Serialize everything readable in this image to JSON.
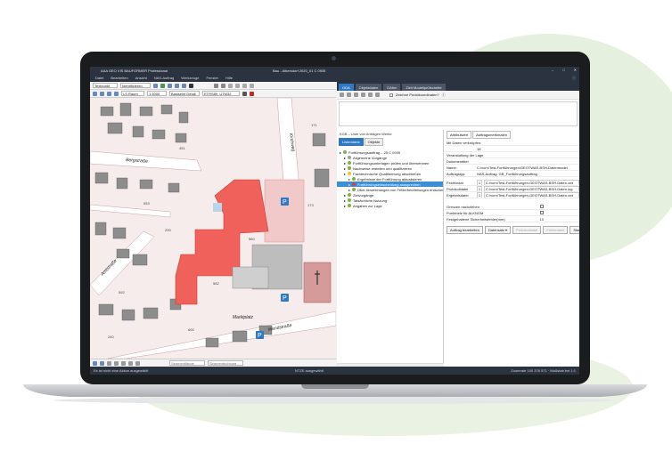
{
  "window": {
    "app_title": "AAA GEO VIS BAUFORMER Professional",
    "center_title": "Bau - Albersdorf 2020_01 C 0935",
    "controls": [
      "–",
      "□",
      "✕"
    ]
  },
  "menu": [
    "Datei",
    "Bearbeiten",
    "Ansicht",
    "NAS-Auftrag",
    "Werkzeuge",
    "Fenster",
    "Hilfe"
  ],
  "toolbar1": {
    "object_combo": "Textpunkt",
    "find_combo": "Identifizieren"
  },
  "toolbar2": {
    "crs_combo": "LS Raum",
    "scale_combo": "1:1000",
    "style_combo": "Basiseinf Detail",
    "layer_combo": "ETRS89_UTM32"
  },
  "map": {
    "streets": [
      "Bergstraße",
      "Kirchweg",
      "Amtstraße",
      "Wendstraße",
      "Marktplatz"
    ],
    "parcel_numbers": [
      "171",
      "560",
      "553",
      "582",
      "173",
      "592",
      "451",
      "200",
      "240",
      "600"
    ],
    "parking_label": "P"
  },
  "map_toolbar": {
    "segment_input_placeholder": "Segmentlänge",
    "segment_input2_placeholder": "Segmentrichtung"
  },
  "status": {
    "left": "Es ist nicht eine Aktion ausgewählt",
    "center": "NTZE ausgewählt",
    "right": "Zoomrate 100 376 571 · Maßstab bei 1:1"
  },
  "right_tabs": [
    "GDA",
    "Objektdaten",
    "DAfen",
    "Zielt Modellprüfschritte"
  ],
  "right_toolbar_check": "Zeichne Punktkoordinaten?",
  "tree": {
    "header": "KGB – Liste von Anträgen Werke",
    "subtabs": [
      "Listendarst",
      "Objekte"
    ],
    "items": [
      {
        "label": "Fortführungsauftrag – 25 C 0935",
        "color": "#7cb342",
        "indent": 0
      },
      {
        "label": "Allgemeine Vorgänge",
        "color": "#9e9e9e",
        "indent": 1
      },
      {
        "label": "Fortführungsunterlagen prüfen und übernehmen",
        "color": "#7cb342",
        "indent": 1
      },
      {
        "label": "Nachweise erstellen und qualifizieren",
        "color": "#7cb342",
        "indent": 1
      },
      {
        "label": "Fachtechnische Qualifizierung abschließen",
        "color": "#fbc02d",
        "indent": 1
      },
      {
        "label": "Ergebnisse der Fortführung aktualisieren",
        "color": "#7cb342",
        "indent": 2
      },
      {
        "label": "Fortführungsentscheidung aussprechen",
        "color": "#e53935",
        "indent": 2,
        "selected": true
      },
      {
        "label": "Über Abweichungen von Fehlerbeurteilungen entscheiden",
        "color": "#7cb342",
        "indent": 2
      },
      {
        "label": "Zielvorgänge",
        "color": "#7cb342",
        "indent": 1
      },
      {
        "label": "Tatsächliche Nutzung",
        "color": "#7cb342",
        "indent": 1
      },
      {
        "label": "Angaben zur Lage",
        "color": "#7cb342",
        "indent": 1
      }
    ]
  },
  "props": {
    "tabs": [
      "Attributwert",
      "Auftragsmerkmalen"
    ],
    "rows": [
      {
        "lab": "Mit Daten verknüpfen:",
        "val": ""
      },
      {
        "lab": "",
        "val": "16"
      },
      {
        "lab": "Veranstaltung der Lage",
        "val": ""
      },
      {
        "lab": "Dokumenttitel",
        "val": ""
      },
      {
        "lab": "Name:",
        "val": "C:\\vorn\\Test-Fortführungen\\GEOTWAS-BSH-Datenmodel"
      },
      {
        "lab": "Auftragstyp:",
        "val": "NAS-Auftrag: GB_Fortführungsauftrag"
      }
    ],
    "files": [
      {
        "lab": "Feldeindat",
        "num": "1",
        "val": "C:\\vorn\\Test-Fortführungen-GEOTWAS-BSH-Daten.xml"
      },
      {
        "lab": "Protokolldatei",
        "num": "1",
        "val": "C:\\vorn\\Test-Fortführungen-GEOTWAS-BSH-Daten.log"
      },
      {
        "lab": "Ergebnisdatei",
        "num": "1",
        "val": "C:\\vorn\\Test-Fortführungen-GEOTWAS-BSH-Daten.xml"
      }
    ],
    "checks": [
      {
        "lab": "Grenzen nachziehen"
      },
      {
        "lab": "Punktnetz für ALKNOM"
      },
      {
        "lab": "Festgehaltene Sicherheitsfehler(mm)",
        "val": "10"
      }
    ],
    "buttons": [
      {
        "label": "Auftrag bearbeiten",
        "disabled": false
      },
      {
        "label": "Datensatz ▾",
        "disabled": false
      },
      {
        "label": "Protokolldatei",
        "disabled": true
      },
      {
        "label": "Fehlerdatei",
        "disabled": true
      },
      {
        "label": "Starten",
        "disabled": false
      }
    ]
  }
}
